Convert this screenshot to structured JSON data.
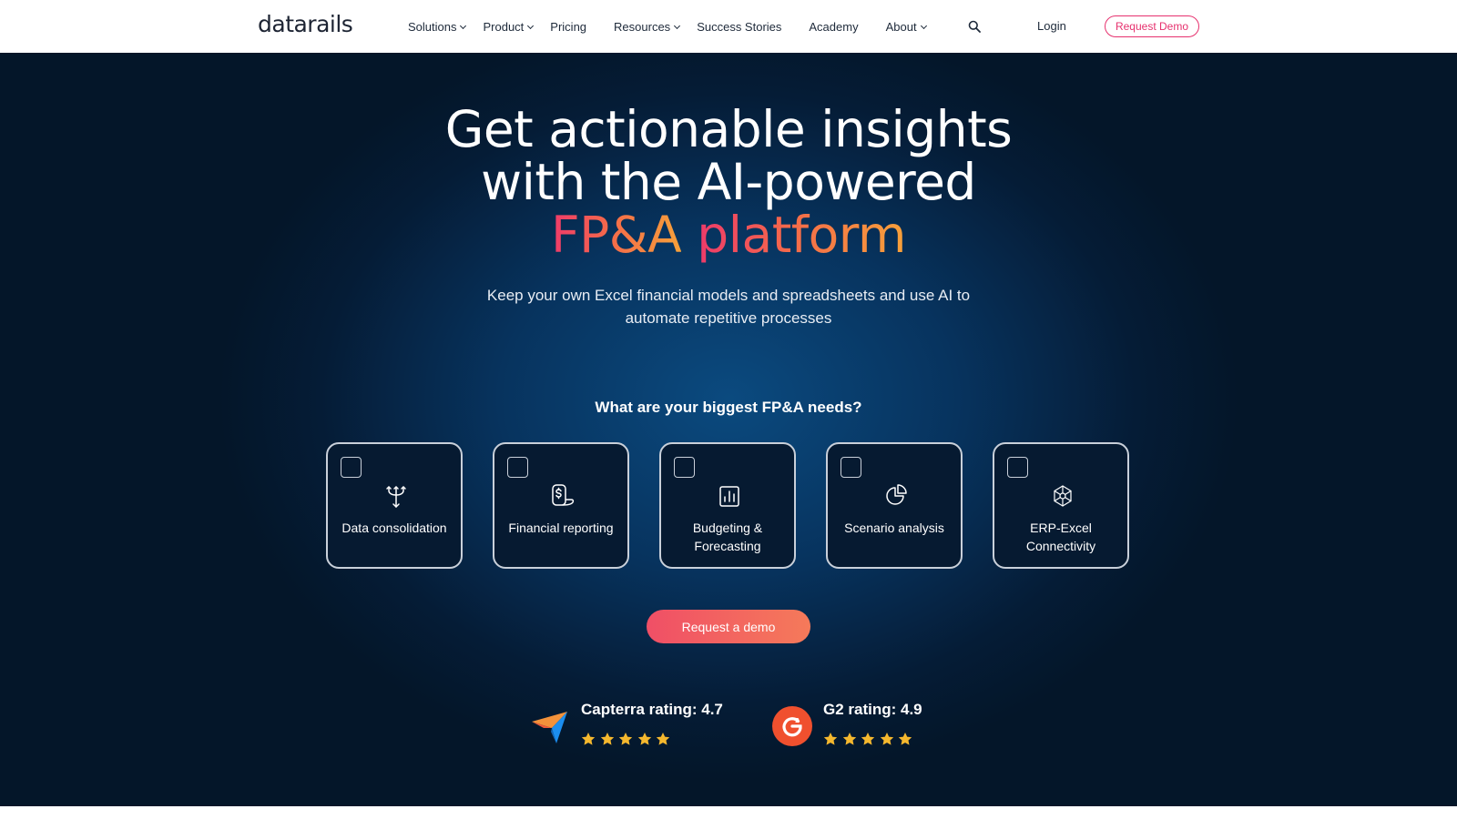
{
  "brand": {
    "logo_text": "datarails"
  },
  "nav": {
    "items": [
      {
        "label": "Solutions",
        "dropdown": true
      },
      {
        "label": "Product",
        "dropdown": true
      },
      {
        "label": "Pricing",
        "dropdown": false
      },
      {
        "label": "Resources",
        "dropdown": true
      },
      {
        "label": "Success Stories",
        "dropdown": false
      },
      {
        "label": "Academy",
        "dropdown": false
      },
      {
        "label": "About",
        "dropdown": true
      }
    ],
    "login": "Login",
    "request_demo": "Request Demo"
  },
  "hero": {
    "headline_line1": "Get actionable insights",
    "headline_line2": "with the AI-powered",
    "headline_accent1": "FP&A",
    "headline_accent2": "platform",
    "subtext": "Keep your own Excel financial models and spreadsheets and use AI to automate repetitive processes",
    "needs_question": "What are your biggest FP&A needs?",
    "cta": "Request a demo"
  },
  "cards": [
    {
      "label": "Data consolidation",
      "icon": "merge-arrows-icon",
      "checked": false
    },
    {
      "label": "Financial reporting",
      "icon": "dollar-report-icon",
      "checked": false
    },
    {
      "label": "Budgeting & Forecasting",
      "icon": "bar-chart-icon",
      "checked": false
    },
    {
      "label": "Scenario analysis",
      "icon": "pie-chart-icon",
      "checked": false
    },
    {
      "label": "ERP-Excel Connectivity",
      "icon": "network-connect-icon",
      "checked": false
    }
  ],
  "ratings": {
    "capterra": {
      "label": "Capterra rating: 4.7",
      "stars": 5
    },
    "g2": {
      "label": "G2 rating: 4.9",
      "stars": 5
    }
  },
  "colors": {
    "accent_pink": "#e6316e",
    "gradient_start": "#ee3a6a",
    "gradient_end": "#f7a13a",
    "hero_dark": "#051c36",
    "star_yellow": "#f5b82e"
  }
}
